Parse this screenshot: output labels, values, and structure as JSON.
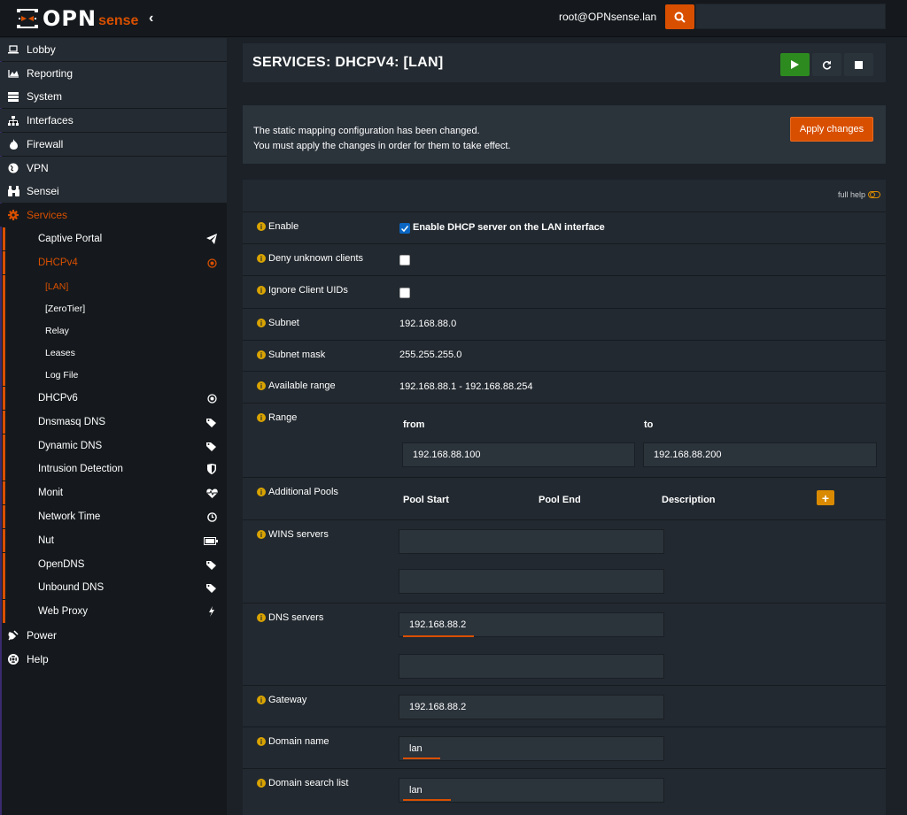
{
  "header": {
    "logo_main": "OPN",
    "logo_accent": "sense",
    "user": "root@OPNsense.lan"
  },
  "sidebar": {
    "items": [
      {
        "label": "Lobby",
        "icon": "laptop-icon"
      },
      {
        "label": "Reporting",
        "icon": "area-chart-icon"
      },
      {
        "label": "System",
        "icon": "server-icon"
      },
      {
        "label": "Interfaces",
        "icon": "sitemap-icon"
      },
      {
        "label": "Firewall",
        "icon": "fire-icon"
      },
      {
        "label": "VPN",
        "icon": "globe-icon"
      },
      {
        "label": "Sensei",
        "icon": "binoculars-icon"
      },
      {
        "label": "Services",
        "icon": "cog-icon"
      },
      {
        "label": "Power",
        "icon": "plug-icon"
      },
      {
        "label": "Help",
        "icon": "lifebuoy-icon"
      }
    ],
    "services": [
      {
        "label": "Captive Portal",
        "icon": "paper-plane-icon"
      },
      {
        "label": "DHCPv4",
        "icon": "bullseye-icon"
      },
      {
        "label": "DHCPv6",
        "icon": "bullseye-icon"
      },
      {
        "label": "Dnsmasq DNS",
        "icon": "tags-icon"
      },
      {
        "label": "Dynamic DNS",
        "icon": "tags-icon"
      },
      {
        "label": "Intrusion Detection",
        "icon": "shield-icon"
      },
      {
        "label": "Monit",
        "icon": "heartbeat-icon"
      },
      {
        "label": "Network Time",
        "icon": "clock-icon"
      },
      {
        "label": "Nut",
        "icon": "battery-icon"
      },
      {
        "label": "OpenDNS",
        "icon": "tags-icon"
      },
      {
        "label": "Unbound DNS",
        "icon": "tags-icon"
      },
      {
        "label": "Web Proxy",
        "icon": "bolt-icon"
      }
    ],
    "dhcpv4_sub": [
      "[LAN]",
      "[ZeroTier]",
      "Relay",
      "Leases",
      "Log File"
    ]
  },
  "page": {
    "title": "SERVICES: DHCPV4: [LAN]"
  },
  "notice": {
    "line1": "The static mapping configuration has been changed.",
    "line2": "You must apply the changes in order for them to take effect.",
    "apply_label": "Apply changes"
  },
  "form": {
    "full_help": "full help",
    "enable_label": "Enable",
    "enable_text": "Enable DHCP server on the LAN interface",
    "deny_label": "Deny unknown clients",
    "ignore_label": "Ignore Client UIDs",
    "subnet_label": "Subnet",
    "subnet_value": "192.168.88.0",
    "mask_label": "Subnet mask",
    "mask_value": "255.255.255.0",
    "avail_label": "Available range",
    "avail_value": "192.168.88.1 - 192.168.88.254",
    "range_label": "Range",
    "range_from_label": "from",
    "range_to_label": "to",
    "range_from": "192.168.88.100",
    "range_to": "192.168.88.200",
    "pools_label": "Additional Pools",
    "pools_cols": [
      "Pool Start",
      "Pool End",
      "Description"
    ],
    "wins_label": "WINS servers",
    "dns_label": "DNS servers",
    "dns1": "192.168.88.2",
    "gateway_label": "Gateway",
    "gateway_value": "192.168.88.2",
    "domain_label": "Domain name",
    "domain_value": "lan",
    "search_label": "Domain search list",
    "search_value": "lan"
  },
  "colors": {
    "accent": "#d94f00",
    "play": "#2d8a1f",
    "info": "#d9a300"
  }
}
